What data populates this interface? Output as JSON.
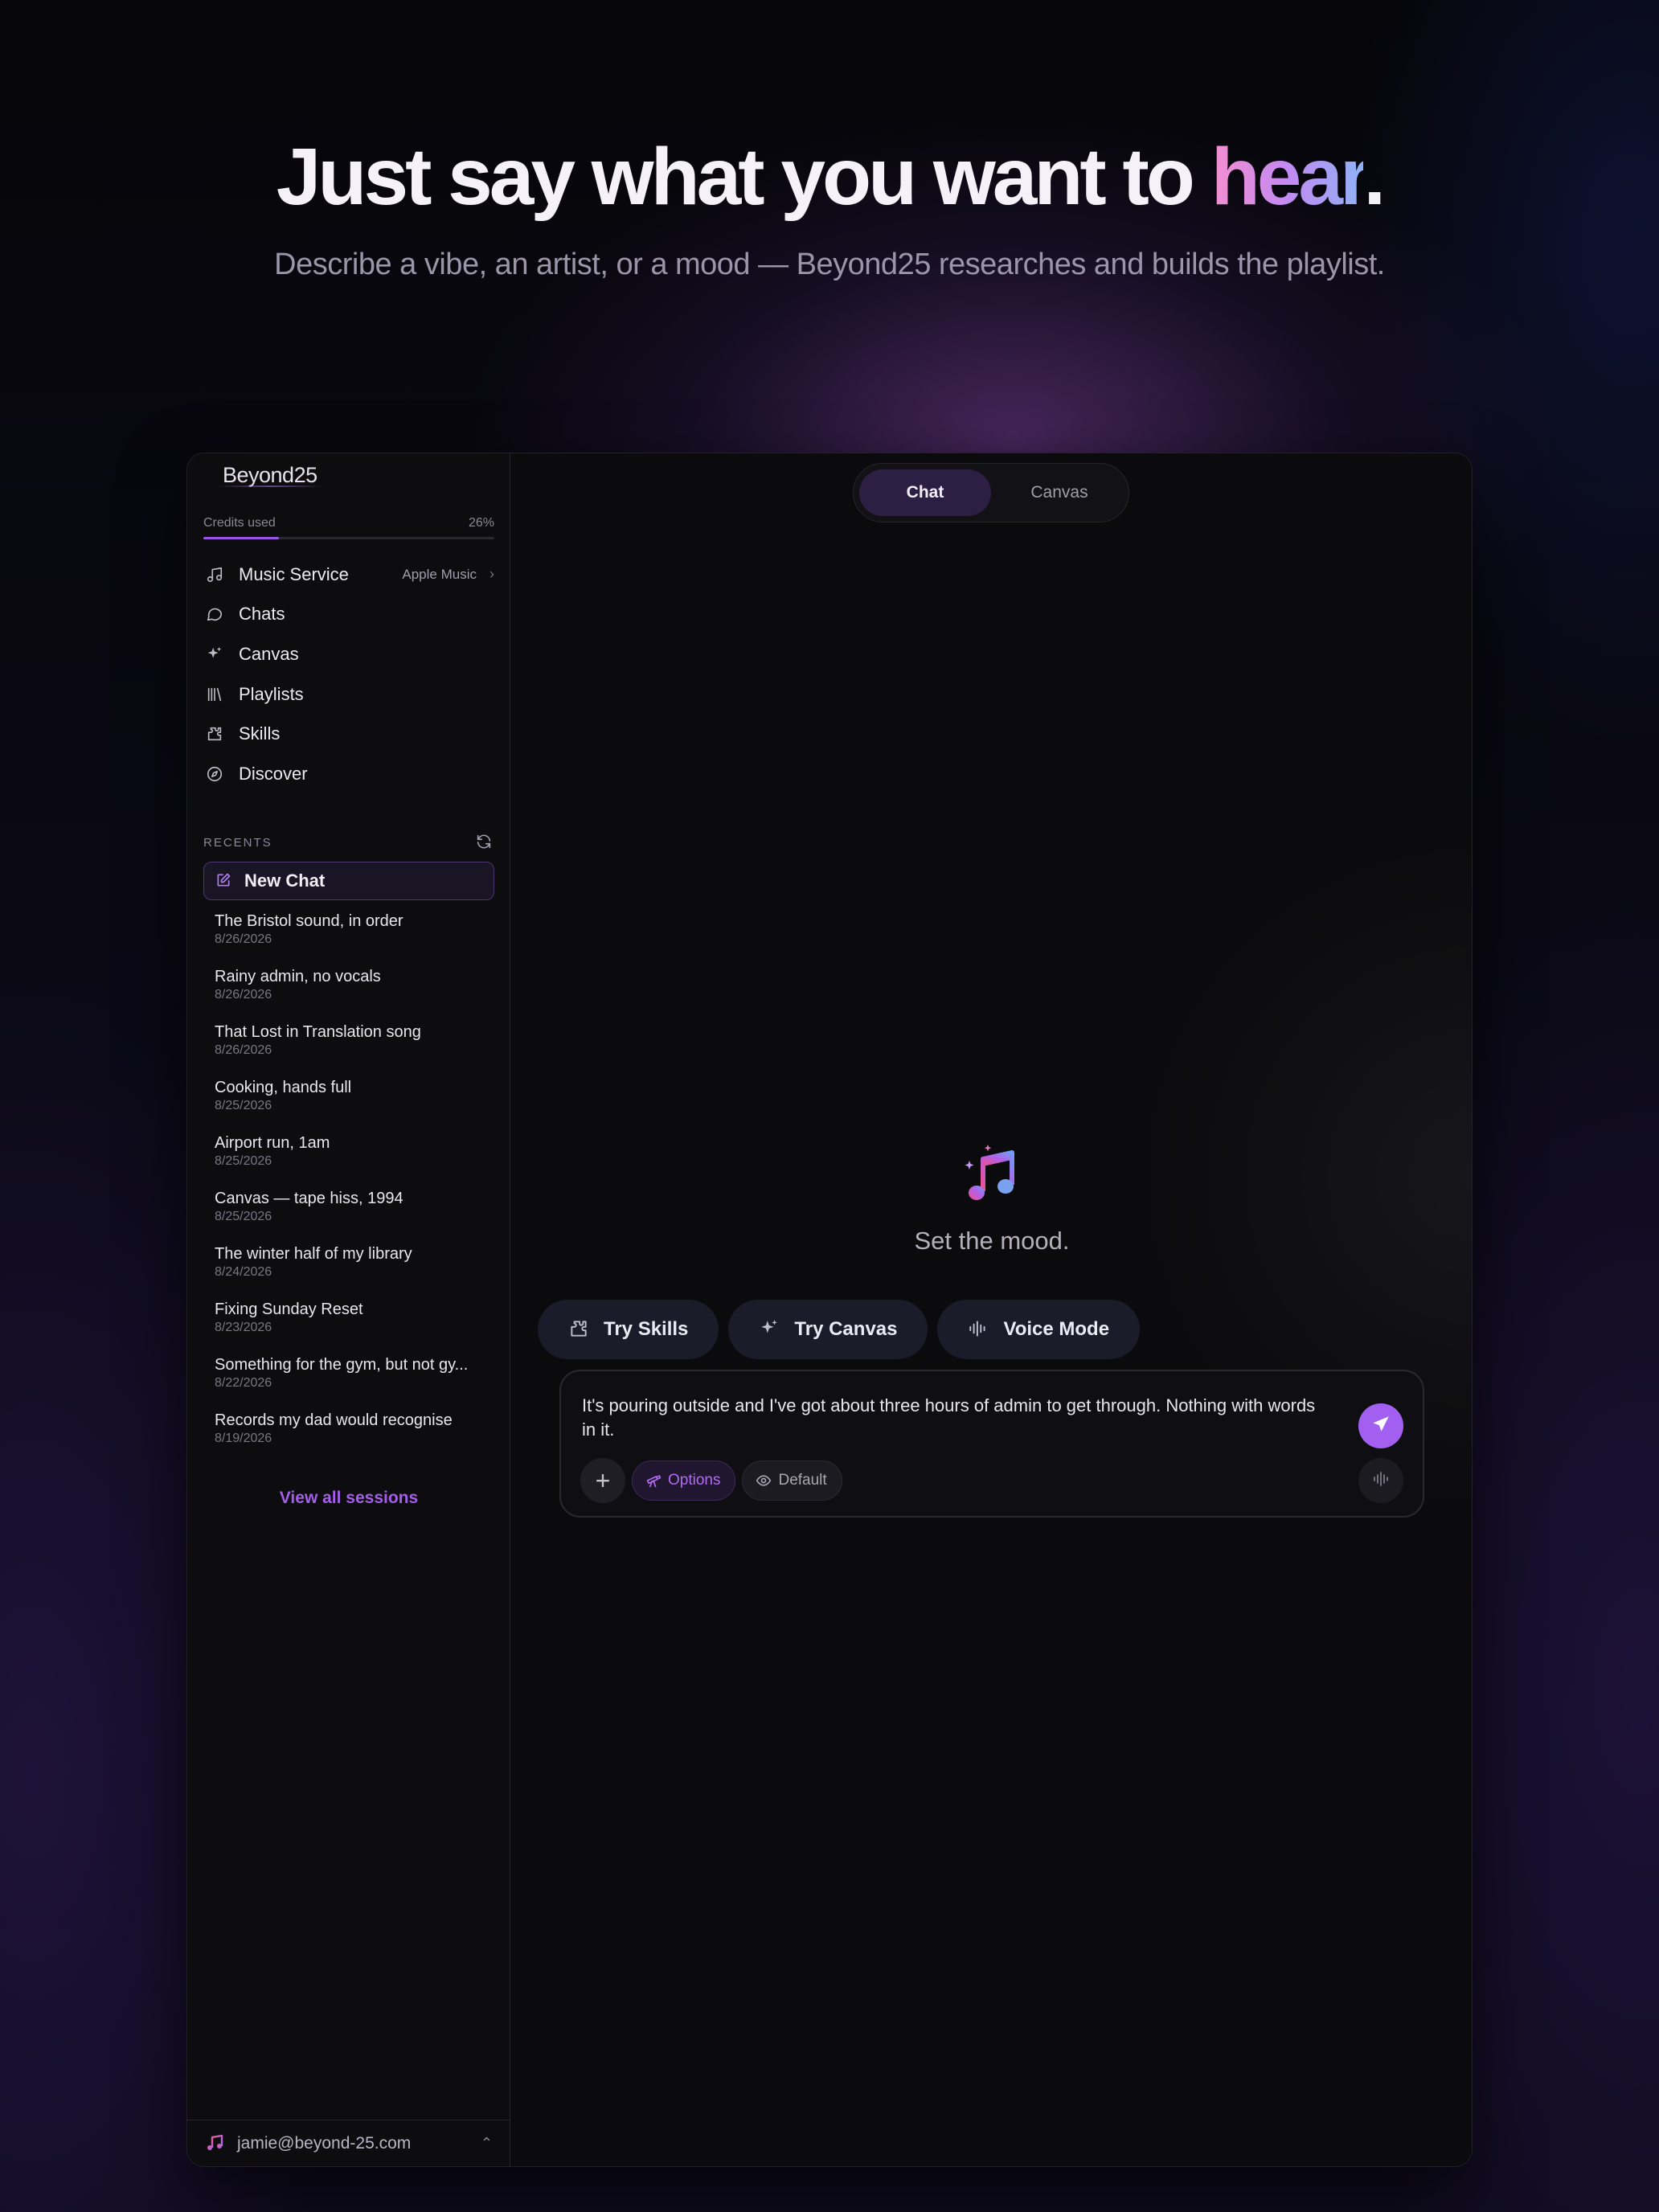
{
  "hero": {
    "title_main": "Just say what you want to ",
    "title_accent": "hear",
    "title_end": ".",
    "subtitle": "Describe a vibe, an artist, or a mood — Beyond25 researches and builds the playlist."
  },
  "sidebar": {
    "logo": "Beyond25",
    "credits": {
      "label": "Credits used",
      "percent_text": "26%",
      "fraction": 0.26
    },
    "nav": [
      {
        "label": "Music Service",
        "icon": "music-note-icon",
        "detail": "Apple Music"
      },
      {
        "label": "Chats",
        "icon": "chat-bubble-icon"
      },
      {
        "label": "Canvas",
        "icon": "sparkle-icon"
      },
      {
        "label": "Playlists",
        "icon": "library-icon"
      },
      {
        "label": "Skills",
        "icon": "puzzle-icon"
      },
      {
        "label": "Discover",
        "icon": "compass-icon"
      }
    ],
    "recents_label": "RECENTS",
    "new_chat_label": "New Chat",
    "recents": [
      {
        "title": "The Bristol sound, in order",
        "date": "8/26/2026"
      },
      {
        "title": "Rainy admin, no vocals",
        "date": "8/26/2026"
      },
      {
        "title": "That Lost in Translation song",
        "date": "8/26/2026"
      },
      {
        "title": "Cooking, hands full",
        "date": "8/25/2026"
      },
      {
        "title": "Airport run, 1am",
        "date": "8/25/2026"
      },
      {
        "title": "Canvas — tape hiss, 1994",
        "date": "8/25/2026"
      },
      {
        "title": "The winter half of my library",
        "date": "8/24/2026"
      },
      {
        "title": "Fixing Sunday Reset",
        "date": "8/23/2026"
      },
      {
        "title": "Something for the gym, but not gy...",
        "date": "8/22/2026"
      },
      {
        "title": "Records my dad would recognise",
        "date": "8/19/2026"
      }
    ],
    "view_all_label": "View all sessions",
    "account_email": "jamie@beyond-25.com"
  },
  "main": {
    "tabs": [
      {
        "label": "Chat",
        "active": true
      },
      {
        "label": "Canvas",
        "active": false
      }
    ],
    "empty_caption": "Set the mood.",
    "quick_actions": [
      {
        "label": "Try Skills",
        "icon": "puzzle-icon"
      },
      {
        "label": "Try Canvas",
        "icon": "sparkle-icon"
      },
      {
        "label": "Voice Mode",
        "icon": "waveform-icon"
      }
    ],
    "composer": {
      "text": "It's pouring outside and I've got about three hours of admin to get through. Nothing with words in it.",
      "options_label": "Options",
      "default_label": "Default"
    }
  },
  "colors": {
    "accent": "#a35ff0",
    "accent_text": "#a45ee9",
    "background": "#07070b"
  }
}
